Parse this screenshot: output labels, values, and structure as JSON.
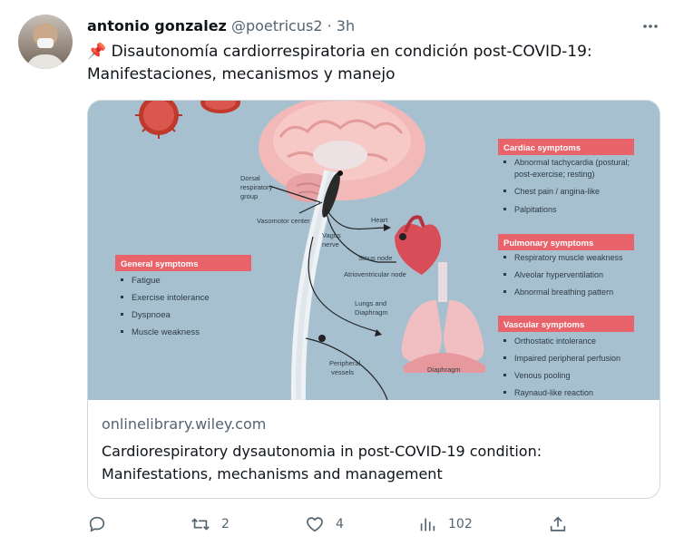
{
  "tweet": {
    "author_name": "antonio gonzalez",
    "author_handle": "@poetricus2",
    "separator": "·",
    "time": "3h",
    "more_glyph": "•••",
    "pin_emoji": "📌",
    "text": "Disautonomía cardiorrespiratoria en condición post-COVID-19: Manifestaciones, mecanismos y manejo"
  },
  "card": {
    "domain": "onlinelibrary.wiley.com",
    "title": "Cardiorespiratory dysautonomia in post-COVID-19 condition: Manifestations, mechanisms and management",
    "image": {
      "labels": {
        "dorsal": [
          "Dorsal",
          "respiratory",
          "group"
        ],
        "vasomotor": "Vasomotor center",
        "vagus": [
          "Vagus",
          "nerve"
        ],
        "heart": "Heart",
        "sinus": "Sinus node",
        "av": "Atrioventricular node",
        "lungs": [
          "Lungs and",
          "Diaphragm"
        ],
        "peripheral": [
          "Peripheral",
          "vessels"
        ],
        "diaphragm": "Diaphragm"
      },
      "general": {
        "title": "General symptoms",
        "items": [
          "Fatigue",
          "Exercise intolerance",
          "Dyspnoea",
          "Muscle weakness"
        ]
      },
      "cardiac": {
        "title": "Cardiac symptoms",
        "items": [
          "Abnormal tachycardia (postural;",
          "post-exercise; resting)",
          "Chest pain / angina-like",
          "Palpitations"
        ]
      },
      "pulmonary": {
        "title": "Pulmonary symptoms",
        "items": [
          "Respiratory muscle weakness",
          "Alveolar hyperventilation",
          "Abnormal breathing pattern"
        ]
      },
      "vascular": {
        "title": "Vascular symptoms",
        "items": [
          "Orthostatic intolerance",
          "Impaired peripheral perfusion",
          "Venous pooling",
          "Raynaud-like reaction"
        ]
      }
    }
  },
  "actions": {
    "reply": {
      "icon": "reply-icon",
      "count": ""
    },
    "retweet": {
      "icon": "retweet-icon",
      "count": "2"
    },
    "like": {
      "icon": "heart-icon",
      "count": "4"
    },
    "views": {
      "icon": "views-icon",
      "count": "102"
    },
    "share": {
      "icon": "share-icon",
      "count": ""
    }
  },
  "colors": {
    "text": "#0f1419",
    "secondary": "#536471",
    "border": "#cfd9de",
    "image_bg": "#a7c0cf",
    "label_red": "#e8636a"
  }
}
